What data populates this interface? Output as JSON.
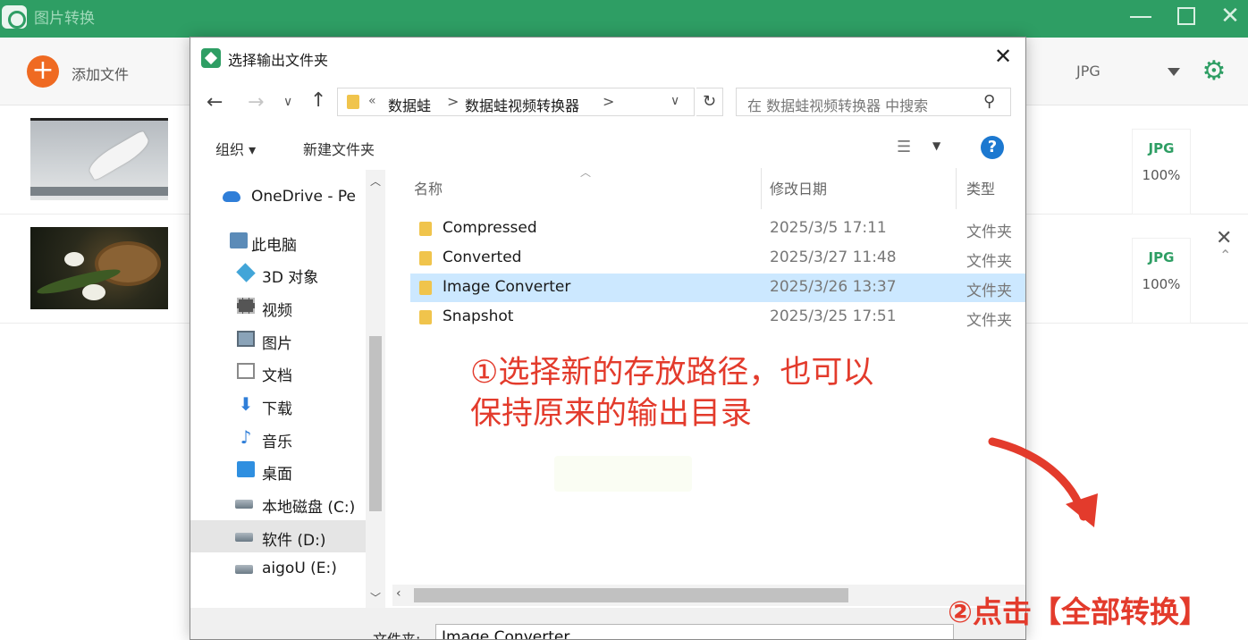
{
  "app": {
    "title": "图片转换",
    "add_label": "添加文件",
    "format_value": "JPG",
    "rows": [
      {
        "format": "JPG",
        "quality": "100%"
      },
      {
        "format": "JPG",
        "quality": "100%"
      }
    ]
  },
  "dialog": {
    "title": "选择输出文件夹",
    "address": {
      "chevron": "«",
      "segments": [
        "数据蛙",
        "数据蛙视频转换器"
      ],
      "sep": ">"
    },
    "search_placeholder": "在 数据蛙视频转换器 中搜索",
    "commands": {
      "organize": "组织 ▾",
      "new_folder": "新建文件夹"
    },
    "nav_items": [
      {
        "label": "OneDrive - Pe",
        "icon": "cloud-icon"
      },
      {
        "label": "此电脑",
        "icon": "computer-icon"
      },
      {
        "label": "3D 对象",
        "icon": "3d-objects-icon"
      },
      {
        "label": "视频",
        "icon": "video-icon"
      },
      {
        "label": "图片",
        "icon": "pictures-icon"
      },
      {
        "label": "文档",
        "icon": "documents-icon"
      },
      {
        "label": "下载",
        "icon": "download-icon"
      },
      {
        "label": "音乐",
        "icon": "music-icon"
      },
      {
        "label": "桌面",
        "icon": "desktop-icon"
      },
      {
        "label": "本地磁盘 (C:)",
        "icon": "drive-icon"
      },
      {
        "label": "软件 (D:)",
        "icon": "drive-icon",
        "selected": true
      },
      {
        "label": "aigoU (E:)",
        "icon": "drive-icon"
      }
    ],
    "columns": {
      "name": "名称",
      "date": "修改日期",
      "type": "类型"
    },
    "files": [
      {
        "name": "Compressed",
        "date": "2025/3/5 17:11",
        "type": "文件夹"
      },
      {
        "name": "Converted",
        "date": "2025/3/27 11:48",
        "type": "文件夹"
      },
      {
        "name": "Image Converter",
        "date": "2025/3/26 13:37",
        "type": "文件夹",
        "selected": true
      },
      {
        "name": "Snapshot",
        "date": "2025/3/25 17:51",
        "type": "文件夹"
      }
    ],
    "folder_label": "文件夹:",
    "folder_value": "Image Converter"
  },
  "annotations": {
    "step1_line1": "①选择新的存放路径，也可以",
    "step1_line2": "保持原来的输出目录",
    "step2": "②点击【全部转换】"
  },
  "colors": {
    "accent": "#2e9e64",
    "annotation": "#e33b2c",
    "selection": "#cce8ff",
    "add_button": "#ef6a22"
  }
}
